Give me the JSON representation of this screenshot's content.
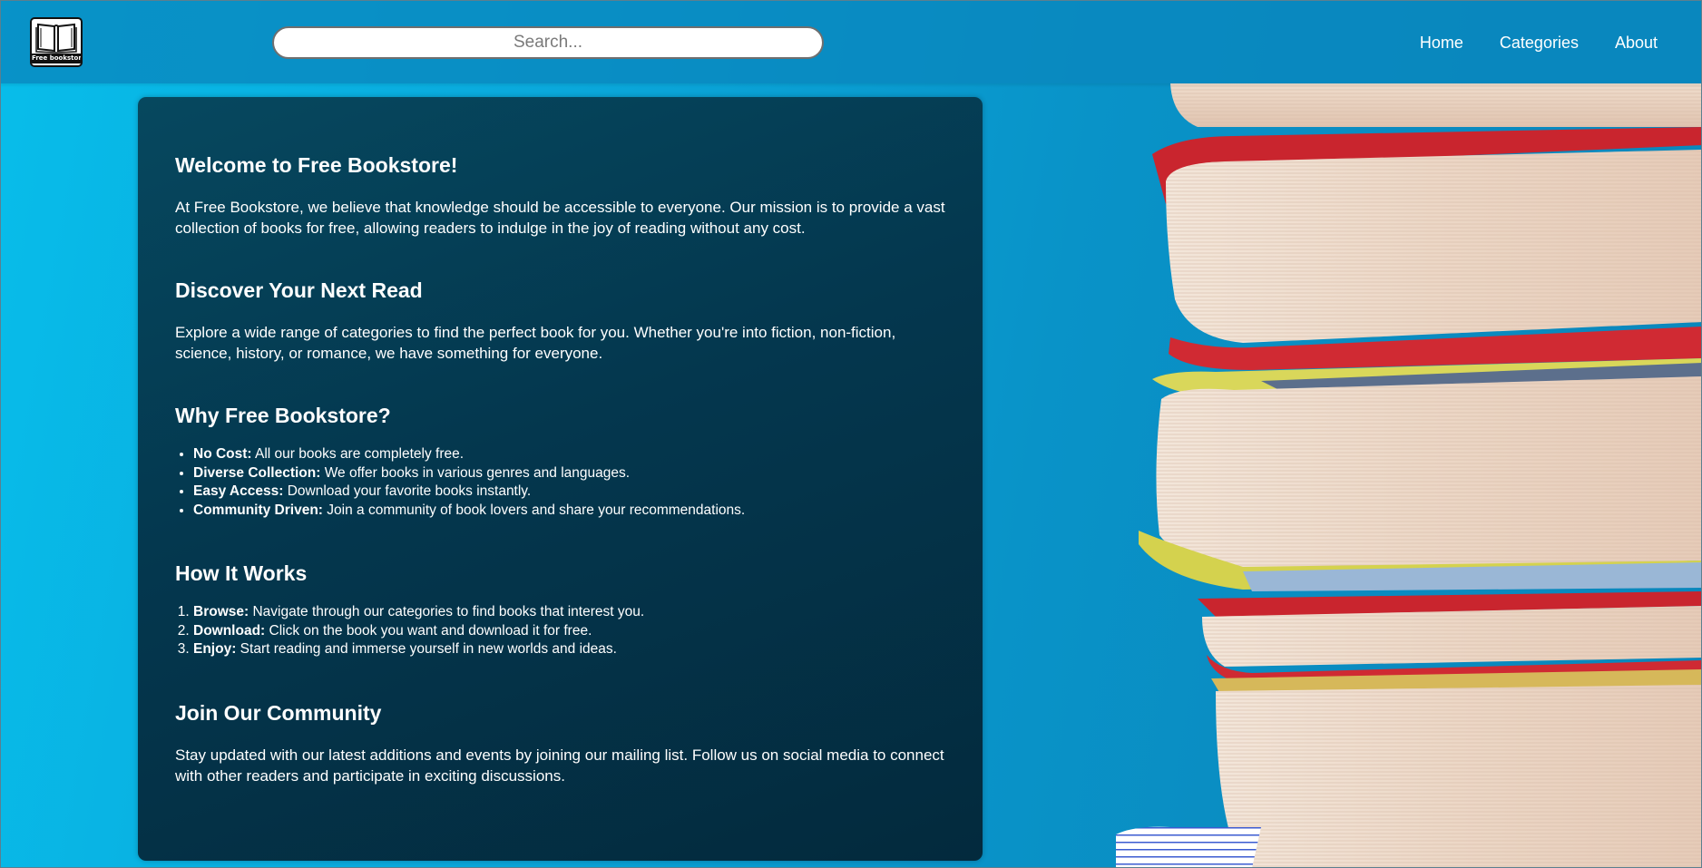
{
  "header": {
    "logo_text": "Free bookstore",
    "search_placeholder": "Search...",
    "nav": [
      "Home",
      "Categories",
      "About"
    ]
  },
  "sections": {
    "welcome": {
      "title": "Welcome to Free Bookstore!",
      "text": "At Free Bookstore, we believe that knowledge should be accessible to everyone. Our mission is to provide a vast collection of books for free, allowing readers to indulge in the joy of reading without any cost."
    },
    "discover": {
      "title": "Discover Your Next Read",
      "text": "Explore a wide range of categories to find the perfect book for you. Whether you're into fiction, non-fiction, science, history, or romance, we have something for everyone."
    },
    "why": {
      "title": "Why Free Bookstore?",
      "items": [
        {
          "label": "No Cost:",
          "text": " All our books are completely free."
        },
        {
          "label": "Diverse Collection:",
          "text": " We offer books in various genres and languages."
        },
        {
          "label": "Easy Access:",
          "text": " Download your favorite books instantly."
        },
        {
          "label": "Community Driven:",
          "text": " Join a community of book lovers and share your recommendations."
        }
      ]
    },
    "how": {
      "title": "How It Works",
      "items": [
        {
          "label": "Browse:",
          "text": " Navigate through our categories to find books that interest you."
        },
        {
          "label": "Download:",
          "text": " Click on the book you want and download it for free."
        },
        {
          "label": "Enjoy:",
          "text": " Start reading and immerse yourself in new worlds and ideas."
        }
      ]
    },
    "community": {
      "title": "Join Our Community",
      "text": "Stay updated with our latest additions and events by joining our mailing list. Follow us on social media to connect with other readers and participate in exciting discussions."
    }
  },
  "colors": {
    "background": "#0aa9dc",
    "header": "#0986be",
    "panel": "#04374e",
    "text": "#ffffff"
  }
}
